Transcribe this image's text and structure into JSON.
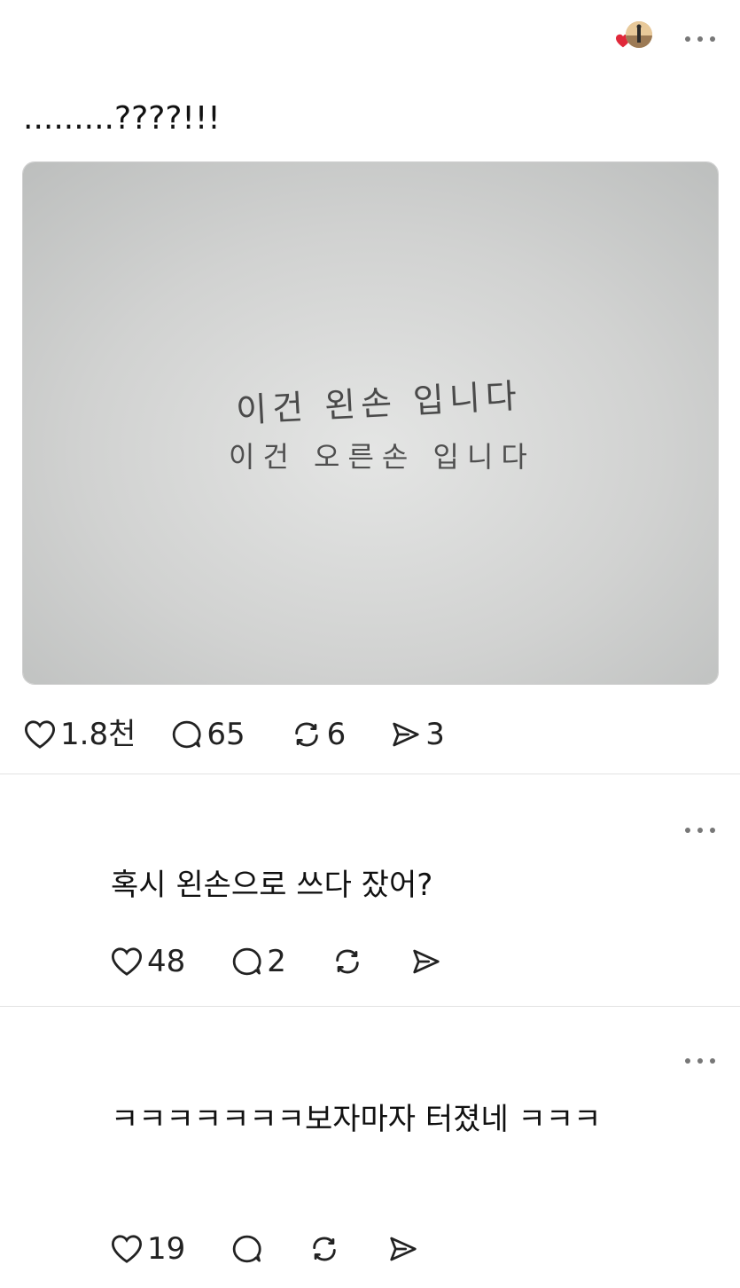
{
  "post": {
    "text": ".........????!!!",
    "photo_handwriting": {
      "line1": "이건 왼손 입니다",
      "line2": "이건 오른손 입니다"
    },
    "stats": {
      "likes": "1.8천",
      "comments": "65",
      "reposts": "6",
      "shares": "3"
    }
  },
  "comments": [
    {
      "text": "혹시 왼손으로 쓰다 잤어?",
      "likes": "48",
      "replies": "2"
    },
    {
      "text": "ㅋㅋㅋㅋㅋㅋㅋ보자마자 터졌네 ㅋㅋㅋ",
      "likes": "19",
      "replies": ""
    }
  ],
  "colors": {
    "accent_heart": "#e0283a",
    "icon": "#222222",
    "divider": "#e3e3e3",
    "paper": "#cfd0cf"
  }
}
